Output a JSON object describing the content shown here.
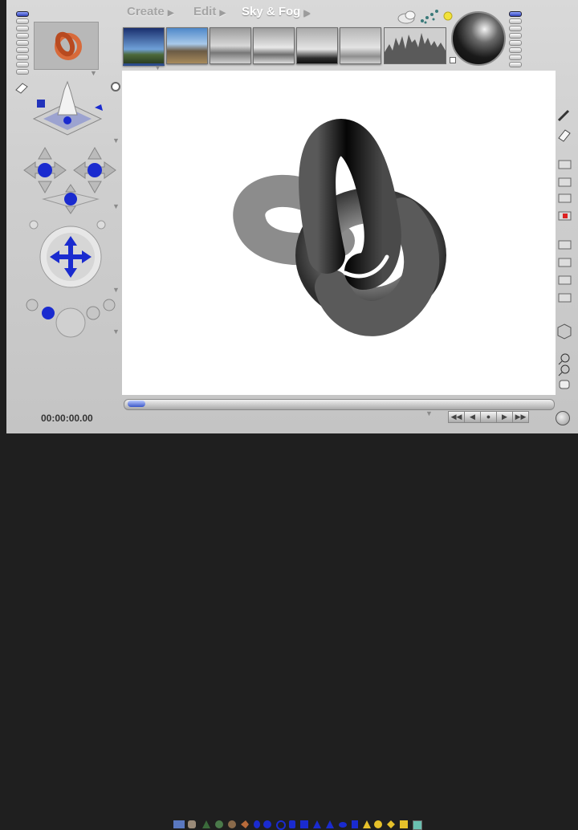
{
  "app": {
    "menu": [
      {
        "label": "Create",
        "active": false
      },
      {
        "label": "Edit",
        "active": false
      },
      {
        "label": "Sky & Fog",
        "active": true
      }
    ],
    "time_display": "00:00:00.00"
  },
  "thumbnails": [
    {
      "name": "sky-preset-1",
      "selected": true
    },
    {
      "name": "sky-preset-2",
      "selected": false
    },
    {
      "name": "sky-preset-3",
      "selected": false
    },
    {
      "name": "sky-preset-4",
      "selected": false
    },
    {
      "name": "sky-preset-5",
      "selected": false
    },
    {
      "name": "sky-preset-6",
      "selected": false
    },
    {
      "name": "sky-preset-7",
      "selected": false
    }
  ],
  "colors": {
    "accent_blue": "#1a2bcf",
    "canvas_bg": "#ffffff",
    "sun_yellow": "#f2e23a"
  },
  "icons": {
    "left_panel": [
      "knot-object-icon",
      "home-icon",
      "spike-object-icon",
      "move-xz-icon",
      "move-yz-icon",
      "move-xy-icon",
      "trackball-icon",
      "light-spheres-icon"
    ],
    "right_panel": [
      "pen-icon",
      "eraser-icon",
      "render-icon",
      "window-icon",
      "layers-icon",
      "stop-icon",
      "list-icon",
      "image-icon",
      "panel-icon",
      "export-icon",
      "cube-icon",
      "zoom-in-icon",
      "zoom-out-icon",
      "hand-icon"
    ],
    "bottom_tray": [
      "plane-icon",
      "rock-icon",
      "tree-icon",
      "plant-icon",
      "ball-icon",
      "fish-icon",
      "torus-icon",
      "sphere-icon",
      "cylinder-icon",
      "cube-icon",
      "cone-icon",
      "pyramid-icon",
      "disc-icon"
    ],
    "playback": [
      "rewind-button",
      "step-back-button",
      "play-button",
      "step-forward-button",
      "end-button"
    ]
  }
}
